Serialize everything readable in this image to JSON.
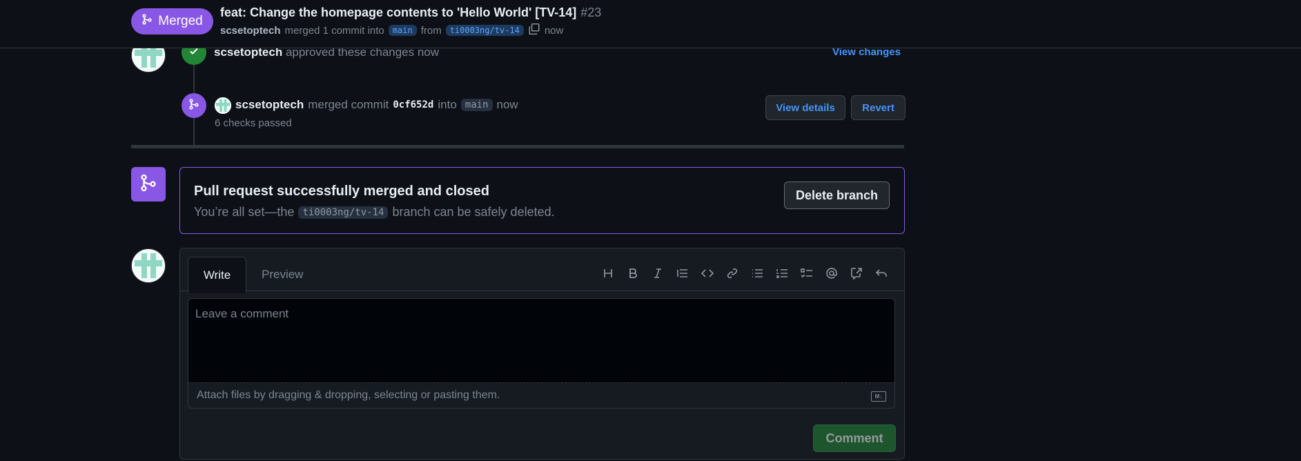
{
  "header": {
    "status_label": "Merged",
    "title": "feat: Change the homepage contents to 'Hello World' [TV-14]",
    "number": "#23",
    "author": "scsetoptech",
    "merged_text": "merged 1 commit into",
    "base_branch": "main",
    "from_text": "from",
    "head_branch": "ti0003ng/tv-14",
    "time": "now"
  },
  "timeline": {
    "approval": {
      "user": "scsetoptech",
      "text": "approved these changes now",
      "link": "View changes"
    },
    "merge_event": {
      "user": "scsetoptech",
      "text": "merged commit",
      "commit": "0cf652d",
      "into_text": "into",
      "branch": "main",
      "time": "now",
      "checks": "6 checks passed",
      "view_details": "View details",
      "revert": "Revert"
    }
  },
  "merge_box": {
    "title": "Pull request successfully merged and closed",
    "desc_prefix": "You’re all set—the",
    "branch": "ti0003ng/tv-14",
    "desc_suffix": "branch can be safely deleted.",
    "delete_button": "Delete branch"
  },
  "comment": {
    "tab_write": "Write",
    "tab_preview": "Preview",
    "placeholder": "Leave a comment",
    "attach_text": "Attach files by dragging & dropping, selecting or pasting them.",
    "markdown_badge": "M↓",
    "submit": "Comment",
    "toolbar_icons": [
      "heading-icon",
      "bold-icon",
      "italic-icon",
      "quote-icon",
      "code-icon",
      "link-icon",
      "unordered-list-icon",
      "ordered-list-icon",
      "task-list-icon",
      "mention-icon",
      "cross-reference-icon",
      "reply-icon"
    ]
  },
  "colors": {
    "background": "#0d1117",
    "merged_purple": "#8957e5",
    "success_green": "#238636",
    "link_blue": "#4493f8"
  }
}
